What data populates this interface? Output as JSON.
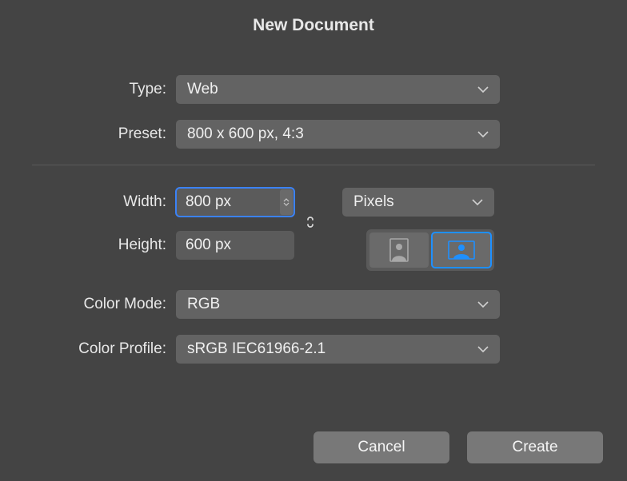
{
  "title": "New Document",
  "labels": {
    "type": "Type:",
    "preset": "Preset:",
    "width": "Width:",
    "height": "Height:",
    "colorMode": "Color Mode:",
    "colorProfile": "Color Profile:"
  },
  "values": {
    "type": "Web",
    "preset": "800 x 600 px, 4:3",
    "width": "800 px",
    "height": "600 px",
    "units": "Pixels",
    "colorMode": "RGB",
    "colorProfile": "sRGB IEC61966-2.1"
  },
  "buttons": {
    "cancel": "Cancel",
    "create": "Create"
  },
  "orientation": "landscape",
  "linkDimensions": false,
  "colors": {
    "accent": "#1e90ff"
  }
}
